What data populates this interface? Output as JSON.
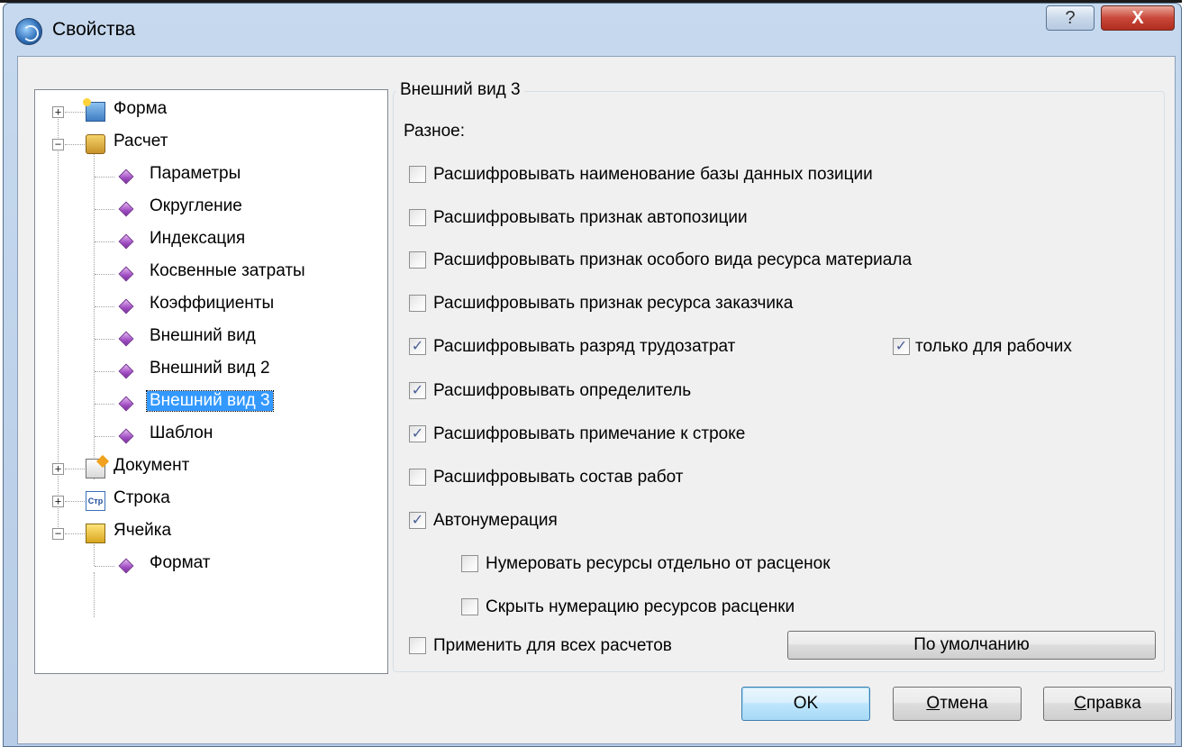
{
  "window": {
    "title": "Свойства",
    "help_glyph": "?",
    "close_glyph": "X"
  },
  "tree": {
    "items": [
      {
        "label": "Форма",
        "expander": "+",
        "icon": "form-icon"
      },
      {
        "label": "Расчет",
        "expander": "−",
        "icon": "calculation-icon"
      },
      {
        "label": "Параметры",
        "icon": "diamond-bullet-icon"
      },
      {
        "label": "Округление",
        "icon": "diamond-bullet-icon"
      },
      {
        "label": "Индексация",
        "icon": "diamond-bullet-icon"
      },
      {
        "label": "Косвенные затраты",
        "icon": "diamond-bullet-icon"
      },
      {
        "label": "Коэффициенты",
        "icon": "diamond-bullet-icon"
      },
      {
        "label": "Внешний вид",
        "icon": "diamond-bullet-icon"
      },
      {
        "label": "Внешний вид 2",
        "icon": "diamond-bullet-icon"
      },
      {
        "label": "Внешний вид 3",
        "icon": "diamond-bullet-icon",
        "selected": true
      },
      {
        "label": "Шаблон",
        "icon": "diamond-bullet-icon"
      },
      {
        "label": "Документ",
        "expander": "+",
        "icon": "document-icon"
      },
      {
        "label": "Строка",
        "expander": "+",
        "icon": "row-icon",
        "icon_text": "Стр"
      },
      {
        "label": "Ячейка",
        "expander": "−",
        "icon": "cell-icon"
      },
      {
        "label": "Формат",
        "icon": "diamond-bullet-icon"
      }
    ]
  },
  "panel": {
    "group_title": "Внешний вид 3",
    "section_label": "Разное:",
    "checkboxes": [
      {
        "label": "Расшифровывать наименование базы данных позиции",
        "checked": false
      },
      {
        "label": "Расшифровывать признак автопозиции",
        "checked": false
      },
      {
        "label": "Расшифровывать признак особого вида ресурса материала",
        "checked": false
      },
      {
        "label": "Расшифровывать признак ресурса заказчика",
        "checked": false
      },
      {
        "label": "Расшифровывать разряд трудозатрат",
        "checked": true
      },
      {
        "label": "Расшифровывать определитель",
        "checked": true
      },
      {
        "label": "Расшифровывать примечание к строке",
        "checked": true
      },
      {
        "label": "Расшифровывать состав работ",
        "checked": false
      },
      {
        "label": "Автонумерация",
        "checked": true
      },
      {
        "label": "Нумеровать ресурсы отдельно от расценок",
        "checked": false
      },
      {
        "label": "Скрыть нумерацию ресурсов расценки",
        "checked": false
      },
      {
        "label": "Применить для всех расчетов",
        "checked": false
      }
    ],
    "workers_only": {
      "label": "только для рабочих",
      "checked": true
    },
    "check_mark": "✓",
    "default_button": "По умолчанию"
  },
  "footer": {
    "ok": "OK",
    "cancel_mnemonic": "О",
    "cancel_rest": "тмена",
    "help_mnemonic": "С",
    "help_rest": "правка"
  }
}
